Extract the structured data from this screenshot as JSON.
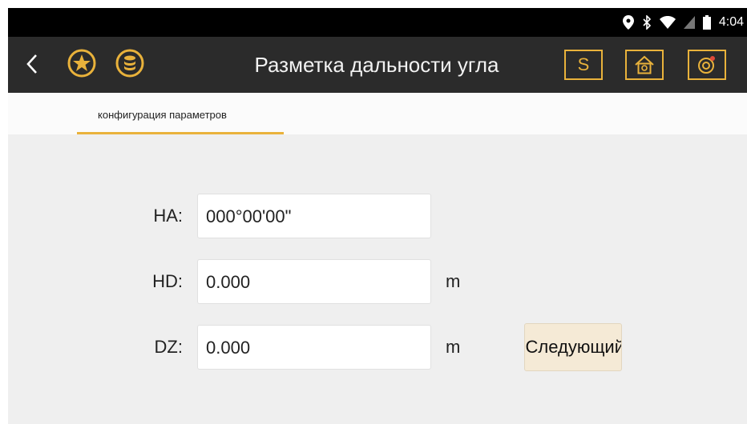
{
  "status_bar": {
    "time": "4:04",
    "icons": [
      "location-icon",
      "bluetooth-icon",
      "wifi-icon",
      "no-sim-icon",
      "battery-icon"
    ]
  },
  "app_bar": {
    "title": "Разметка дальности угла",
    "s_button_label": "S",
    "accent_color": "#e9b23b",
    "background_color": "#2b2b2b"
  },
  "tabs": [
    {
      "label": "конфигурация параметров",
      "selected": true
    }
  ],
  "form": {
    "fields": [
      {
        "label": "HA:",
        "value": "000°00'00\"",
        "unit": ""
      },
      {
        "label": "HD:",
        "value": "0.000",
        "unit": "m"
      },
      {
        "label": "DZ:",
        "value": "0.000",
        "unit": "m"
      }
    ],
    "next_button_label": "Следующий"
  }
}
